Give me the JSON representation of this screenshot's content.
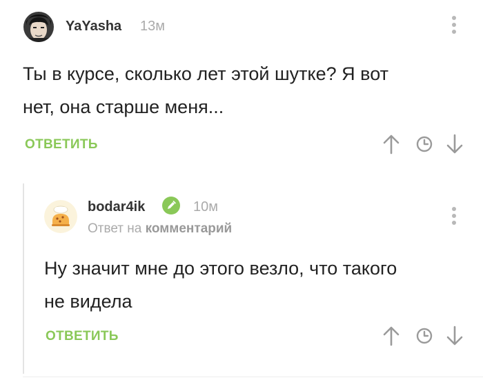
{
  "comment": {
    "username": "YaYasha",
    "time": "13м",
    "text_line1": "Ты в курсе, сколько лет этой шутке? Я вот",
    "text_line2": "нет, она старше меня...",
    "reply_label": "ОТВЕТИТЬ"
  },
  "reply": {
    "username": "bodar4ik",
    "time": "10м",
    "reply_prefix": "Ответ на",
    "reply_target": "комментарий",
    "text_line1": "Ну значит мне до этого везло, что такого",
    "text_line2": "не видела",
    "reply_label": "ОТВЕТИТЬ"
  },
  "colors": {
    "accent_green": "#8ac858",
    "badge_green": "#8ac858",
    "icon_gray": "#9a9a9a"
  },
  "icons": [
    "kebab-menu-icon",
    "arrow-up-icon",
    "clock-icon",
    "arrow-down-icon",
    "pencil-badge-icon"
  ]
}
